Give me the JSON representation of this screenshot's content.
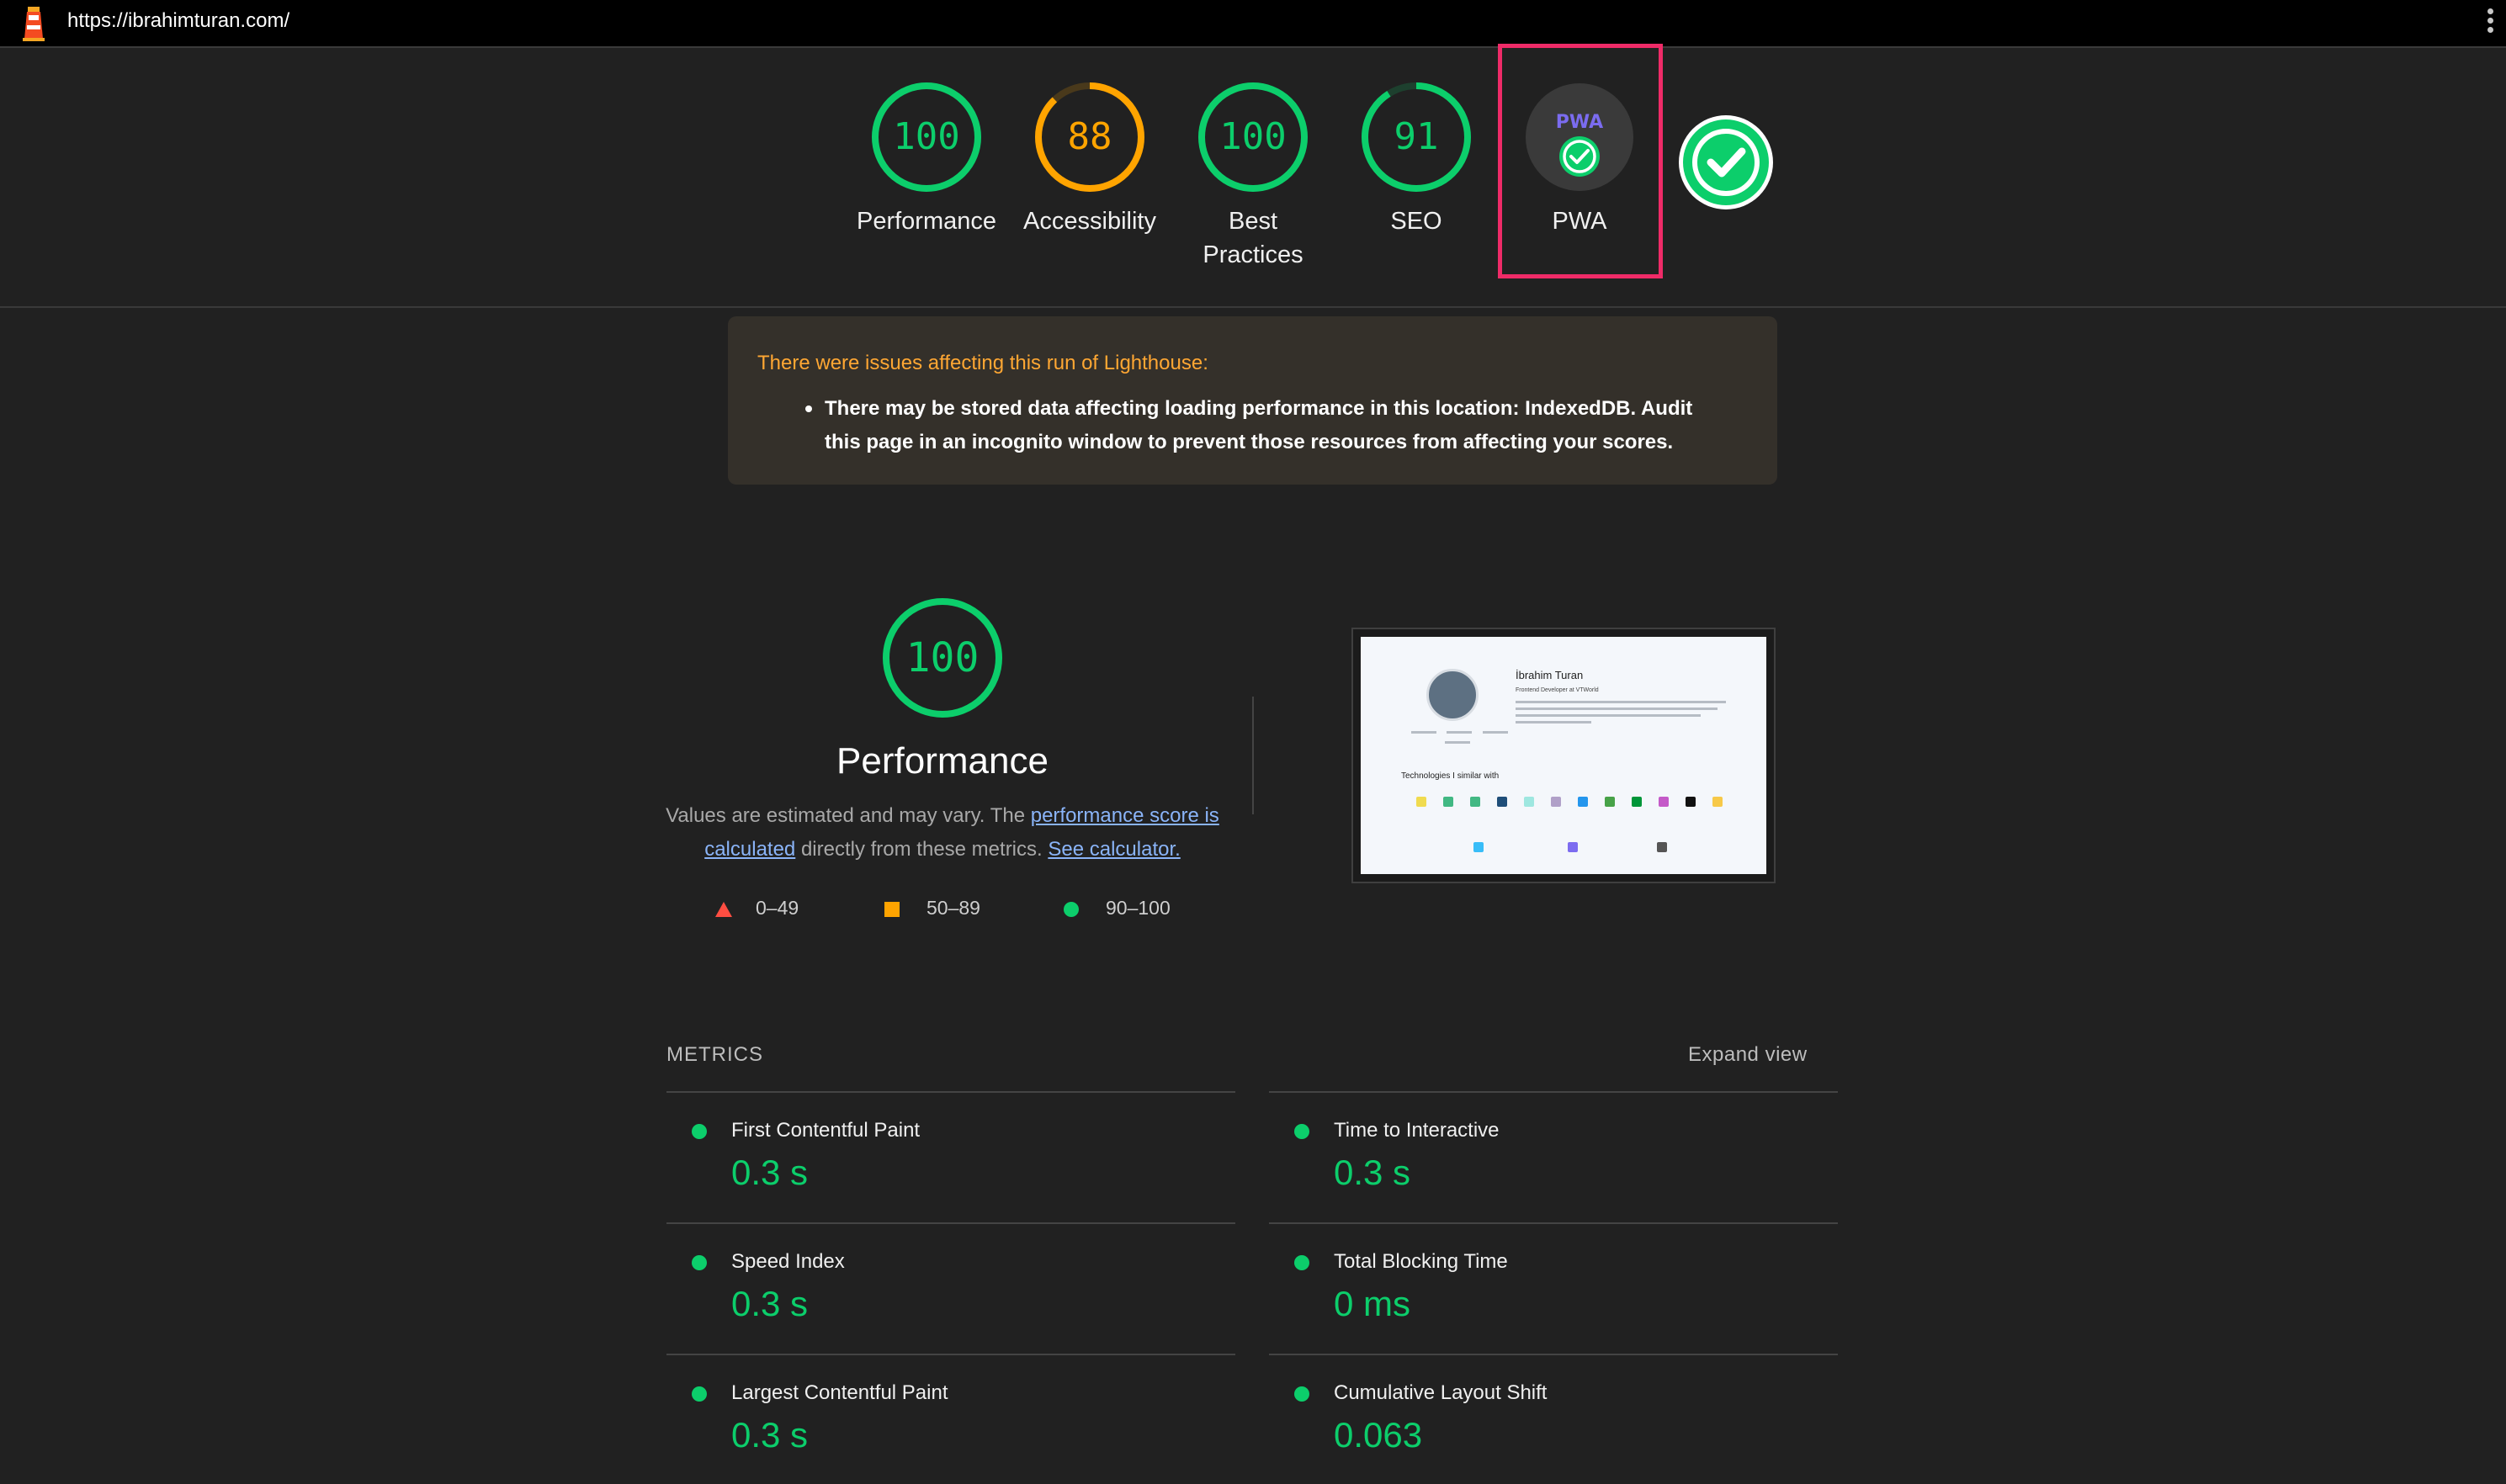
{
  "topbar": {
    "url": "https://ibrahimturan.com/"
  },
  "gauges": [
    {
      "label": "Performance",
      "score": "100",
      "value": 100,
      "color": "#0cce6b"
    },
    {
      "label": "Accessibility",
      "score": "88",
      "value": 88,
      "color": "#ffa400"
    },
    {
      "label": "Best\nPractices",
      "score": "100",
      "value": 100,
      "color": "#0cce6b"
    },
    {
      "label": "SEO",
      "score": "91",
      "value": 91,
      "color": "#0cce6b"
    }
  ],
  "pwa": {
    "label": "PWA",
    "badge_text": "PWA",
    "icon": "pwa-check-icon"
  },
  "warning": {
    "title": "There were issues affecting this run of Lighthouse:",
    "item": "There may be stored data affecting loading performance in this location: IndexedDB. Audit this page in an incognito window to prevent those resources from affecting your scores."
  },
  "performance": {
    "score": "100",
    "value": 100,
    "title": "Performance",
    "desc_prefix": "Values are estimated and may vary. The ",
    "desc_link1": "performance score is calculated",
    "desc_middle": " directly from these metrics. ",
    "desc_link2": "See calculator.",
    "legend": [
      {
        "range": "0–49",
        "color": "#ff4e42",
        "shape": "triangle"
      },
      {
        "range": "50–89",
        "color": "#ffa400",
        "shape": "square"
      },
      {
        "range": "90–100",
        "color": "#0cce6b",
        "shape": "circle"
      }
    ]
  },
  "thumbnail": {
    "name": "İbrahim Turan",
    "subtitle": "Frontend Developer at VTWorld",
    "tech_heading": "Technologies I similar with"
  },
  "metrics": {
    "heading": "METRICS",
    "expand_label": "Expand view",
    "items": [
      {
        "name": "First Contentful Paint",
        "value": "0.3 s"
      },
      {
        "name": "Time to Interactive",
        "value": "0.3 s"
      },
      {
        "name": "Speed Index",
        "value": "0.3 s"
      },
      {
        "name": "Total Blocking Time",
        "value": "0 ms"
      },
      {
        "name": "Largest Contentful Paint",
        "value": "0.3 s"
      },
      {
        "name": "Cumulative Layout Shift",
        "value": "0.063"
      }
    ]
  },
  "colors": {
    "pass": "#0cce6b",
    "average": "#ffa400",
    "fail": "#ff4e42",
    "highlight": "#ef2b68"
  }
}
